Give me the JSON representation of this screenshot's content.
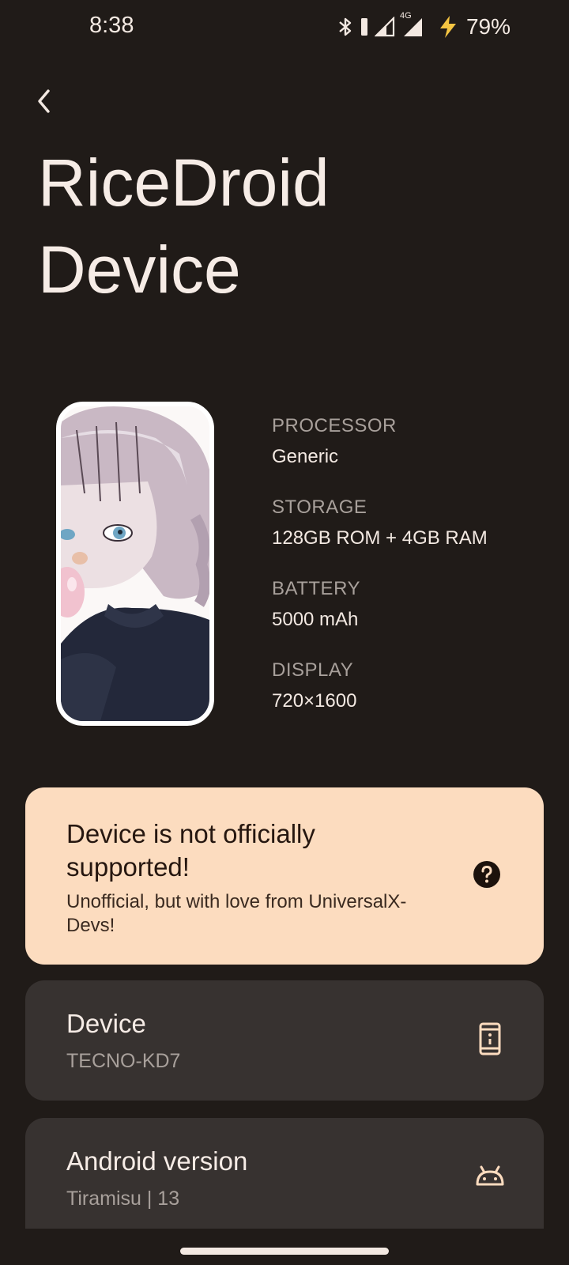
{
  "status_bar": {
    "time": "8:38",
    "network_label": "4G",
    "battery_percent": "79%",
    "icons": [
      "bluetooth-icon",
      "vibrate-icon",
      "signal-icon",
      "signal-4g-icon",
      "charging-icon"
    ]
  },
  "header": {
    "title": "RiceDroid Device"
  },
  "specs": [
    {
      "label": "PROCESSOR",
      "value": "Generic"
    },
    {
      "label": "STORAGE",
      "value": "128GB ROM + 4GB RAM"
    },
    {
      "label": "BATTERY",
      "value": "5000 mAh"
    },
    {
      "label": "DISPLAY",
      "value": "720×1600"
    }
  ],
  "warning_card": {
    "title": "Device is not officially supported!",
    "subtitle": "Unofficial, but with love from UniversalX-Devs!",
    "icon": "help-icon"
  },
  "device_card": {
    "title": "Device",
    "subtitle": "TECNO-KD7",
    "icon": "device-info-icon"
  },
  "android_card": {
    "title": "Android version",
    "subtitle": "Tiramisu | 13",
    "icon": "android-icon"
  },
  "colors": {
    "background": "#201b18",
    "warning_card": "#fcdcbf",
    "info_card": "#373230",
    "accent_icon": "#fcdcbf"
  }
}
